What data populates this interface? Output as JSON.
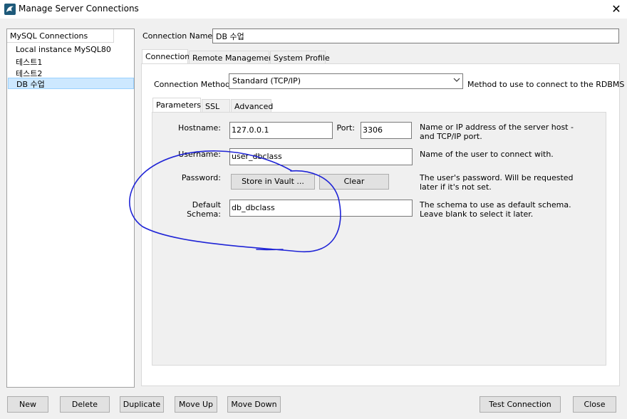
{
  "window": {
    "title": "Manage Server Connections",
    "close_glyph": "✕",
    "icon": "mysql-dolphin-icon"
  },
  "sidebar": {
    "header": "MySQL Connections",
    "items": [
      {
        "label": "Local instance MySQL80",
        "selected": false
      },
      {
        "label": "테스트1",
        "selected": false
      },
      {
        "label": "테스트2",
        "selected": false
      },
      {
        "label": "DB 수업",
        "selected": true
      }
    ]
  },
  "connection_name": {
    "label": "Connection Name:",
    "value": "DB 수업"
  },
  "main_tabs": [
    {
      "label": "Connection",
      "active": true
    },
    {
      "label": "Remote Management",
      "active": false
    },
    {
      "label": "System Profile",
      "active": false
    }
  ],
  "connection_method": {
    "label": "Connection Method:",
    "value": "Standard (TCP/IP)",
    "help": "Method to use to connect to the RDBMS"
  },
  "sub_tabs": [
    {
      "label": "Parameters",
      "active": true
    },
    {
      "label": "SSL",
      "active": false
    },
    {
      "label": "Advanced",
      "active": false
    }
  ],
  "params": {
    "hostname": {
      "label": "Hostname:",
      "value": "127.0.0.1"
    },
    "port": {
      "label": "Port:",
      "value": "3306"
    },
    "hostname_help": "Name or IP address of the server host - and TCP/IP port.",
    "username": {
      "label": "Username:",
      "value": "user_dbclass",
      "help": "Name of the user to connect with."
    },
    "password": {
      "label": "Password:",
      "store_btn": "Store in Vault ...",
      "clear_btn": "Clear",
      "help": "The user's password. Will be requested later if it's not set."
    },
    "schema": {
      "label": "Default Schema:",
      "value": "db_dbclass",
      "help": "The schema to use as default schema. Leave blank to select it later."
    }
  },
  "bottom_buttons": {
    "new": "New",
    "delete": "Delete",
    "duplicate": "Duplicate",
    "move_up": "Move Up",
    "move_down": "Move Down",
    "test": "Test Connection",
    "close": "Close"
  },
  "colors": {
    "selection": "#cde8ff",
    "annotation_ink": "#1f24d6"
  }
}
